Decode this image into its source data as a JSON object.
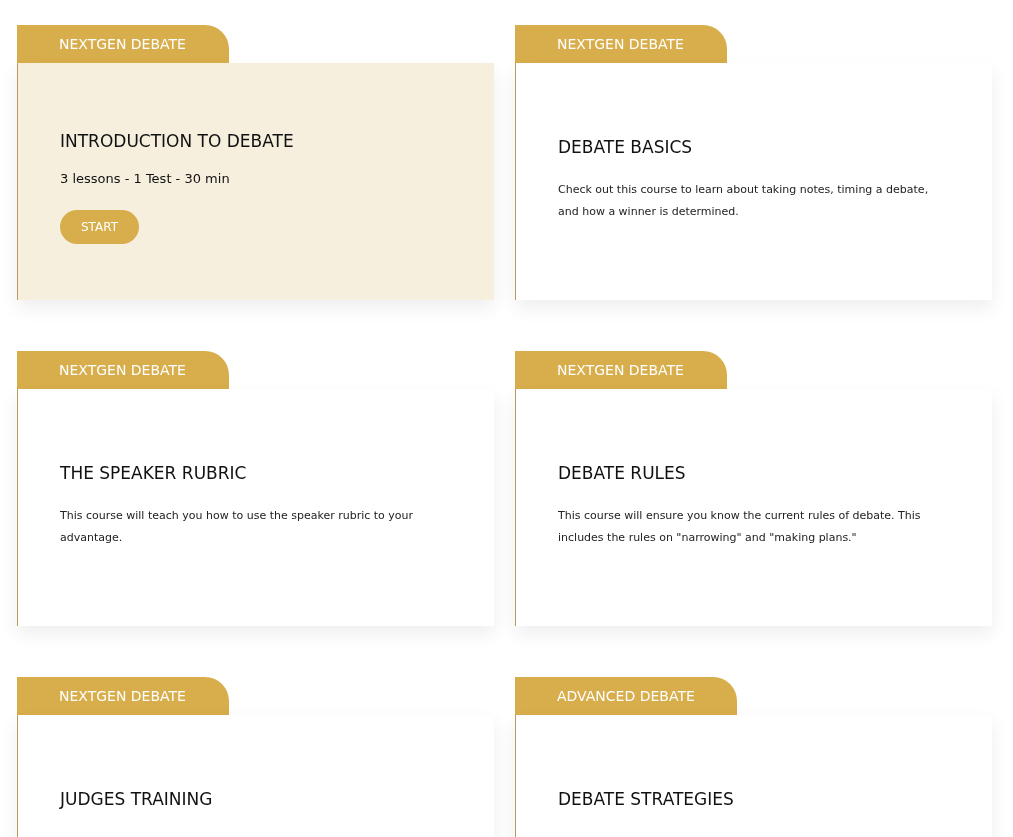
{
  "courses": [
    {
      "tag": "NEXTGEN DEBATE",
      "title": "INTRODUCTION TO DEBATE",
      "meta": "3 lessons - 1 Test - 30 min",
      "button": "START",
      "selected": true
    },
    {
      "tag": "NEXTGEN DEBATE",
      "title": "DEBATE BASICS",
      "description": "Check out this course to learn about taking notes, timing a debate, and how a winner is determined.",
      "selected": false
    },
    {
      "tag": "NEXTGEN DEBATE",
      "title": "THE SPEAKER RUBRIC",
      "description": "This course will teach you how to use the speaker rubric to your advantage.",
      "selected": false
    },
    {
      "tag": "NEXTGEN DEBATE",
      "title": "DEBATE RULES",
      "description": "This course will ensure you know the current rules of debate. This includes the rules on \"narrowing\" and \"making plans.\"",
      "selected": false
    },
    {
      "tag": "NEXTGEN DEBATE",
      "title": "JUDGES TRAINING",
      "selected": false
    },
    {
      "tag": "ADVANCED DEBATE",
      "title": "DEBATE STRATEGIES",
      "selected": false
    }
  ]
}
